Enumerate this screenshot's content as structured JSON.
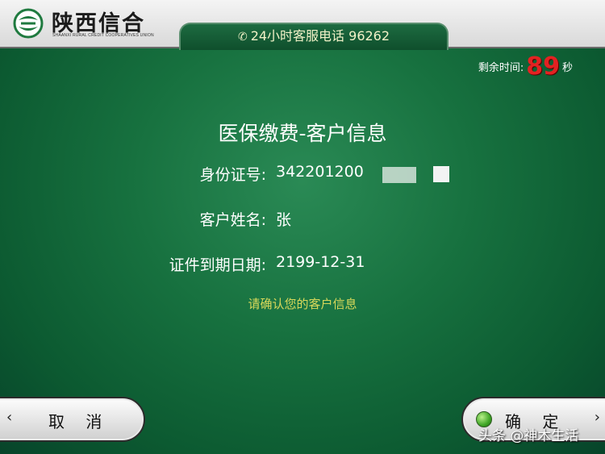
{
  "header": {
    "bank_name": "陕西信合",
    "bank_name_en": "SHAANXI RURAL CREDIT COOPERATIVES UNION",
    "hotline_icon": "phone-icon",
    "hotline": "24小时客服电话 96262"
  },
  "timer": {
    "label": "剩余时间:",
    "value": "89",
    "unit": "秒"
  },
  "page": {
    "title": "医保缴费-客户信息",
    "fields": [
      {
        "label": "身份证号:",
        "value": "342201200"
      },
      {
        "label": "客户姓名:",
        "value": "张"
      },
      {
        "label": "证件到期日期:",
        "value": "2199-12-31"
      }
    ],
    "hint": "请确认您的客户信息"
  },
  "buttons": {
    "cancel": "取 消",
    "confirm": "确 定",
    "left_chevron": "‹",
    "right_chevron": "›"
  },
  "watermark": "头条 @神木生活",
  "colors": {
    "background": "#17713f",
    "timer_number": "#e32222",
    "hint": "#d8d85a",
    "text": "#ffffff"
  }
}
